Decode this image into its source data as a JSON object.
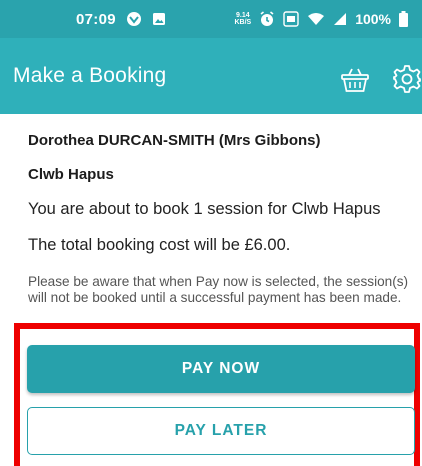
{
  "status_bar": {
    "time": "07:09",
    "net_speed_top": "9.14",
    "net_speed_bottom": "KB/S",
    "battery": "100%"
  },
  "app_bar": {
    "title": "Make a Booking",
    "icons": [
      "basket-icon",
      "gear-icon"
    ]
  },
  "booking": {
    "member_name": "Dorothea DURCAN-SMITH (Mrs Gibbons)",
    "club": "Clwb Hapus",
    "session_text": "You are about to book 1 session for Clwb Hapus",
    "cost_text": "The total booking cost will be £6.00.",
    "note": "Please be aware that when Pay now is selected, the session(s) will not be booked until a successful payment has been made."
  },
  "actions": {
    "pay_now_label": "PAY NOW",
    "pay_later_label": "PAY LATER"
  },
  "colors": {
    "status_bar": "#2aa3ad",
    "app_bar": "#2fb0ba",
    "button": "#27a1ab",
    "highlight": "#ee0000"
  }
}
